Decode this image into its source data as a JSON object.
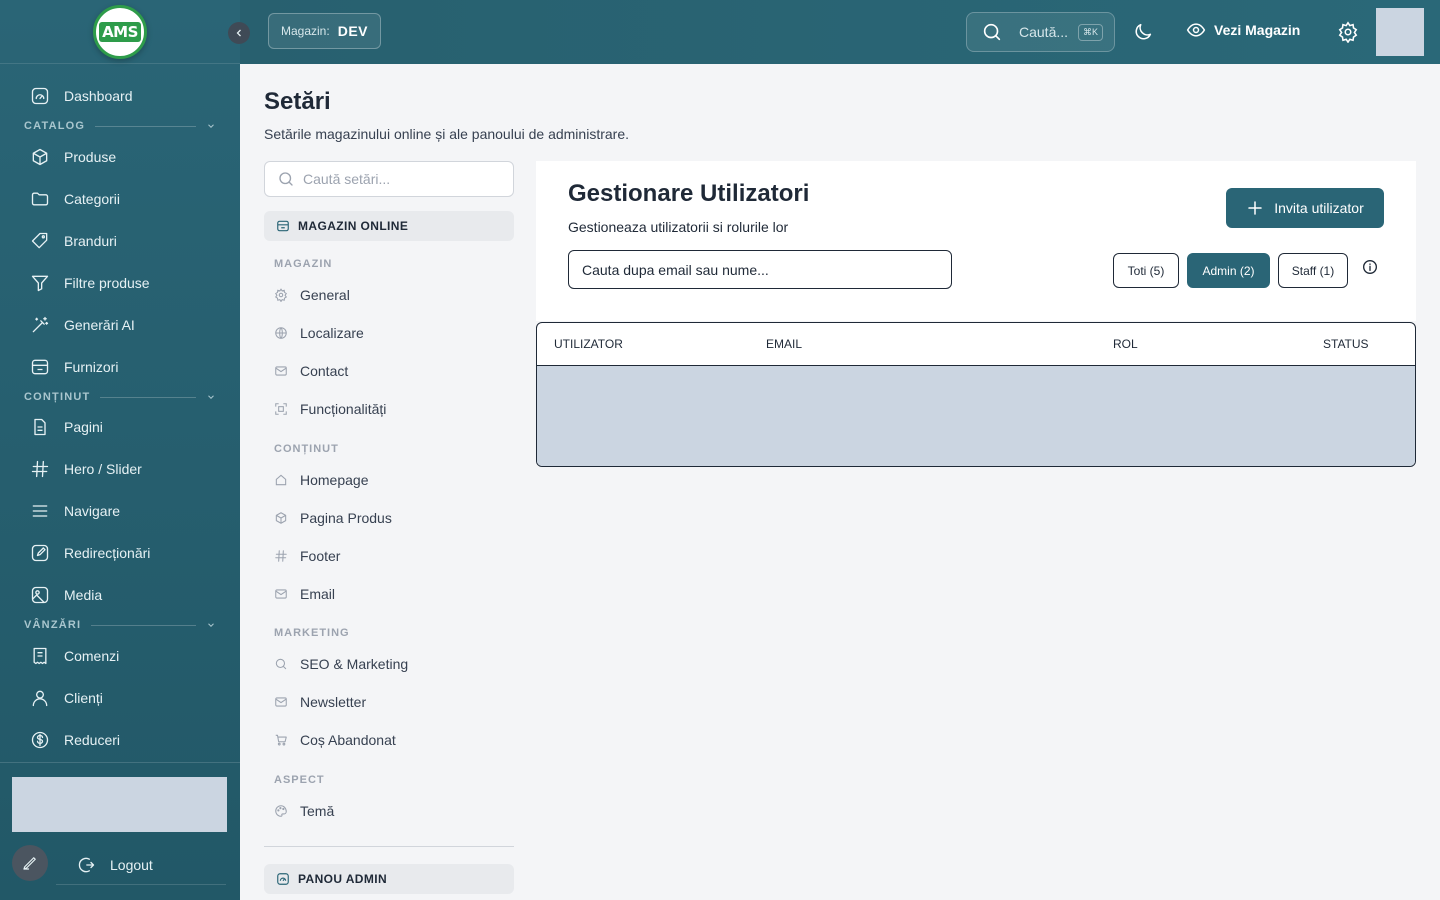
{
  "sidebar": {
    "logo_text": "AMS",
    "items": [
      {
        "label": "Dashboard",
        "icon": "gauge-icon"
      },
      {
        "label": "Produse",
        "icon": "box-icon"
      },
      {
        "label": "Categorii",
        "icon": "folder-icon"
      },
      {
        "label": "Branduri",
        "icon": "tag-icon"
      },
      {
        "label": "Filtre produse",
        "icon": "filter-icon"
      },
      {
        "label": "Generări AI",
        "icon": "wand-icon"
      },
      {
        "label": "Furnizori",
        "icon": "store-icon"
      },
      {
        "label": "Pagini",
        "icon": "file-icon"
      },
      {
        "label": "Hero / Slider",
        "icon": "hash-icon"
      },
      {
        "label": "Navigare",
        "icon": "menu-icon"
      },
      {
        "label": "Redirecționări",
        "icon": "edit-icon"
      },
      {
        "label": "Media",
        "icon": "image-icon"
      },
      {
        "label": "Comenzi",
        "icon": "receipt-icon"
      },
      {
        "label": "Clienți",
        "icon": "user-icon"
      },
      {
        "label": "Reduceri",
        "icon": "dollar-icon"
      }
    ],
    "sections": [
      "CATALOG",
      "CONȚINUT",
      "VÂNZĂRI"
    ],
    "logout_label": "Logout"
  },
  "topbar": {
    "store_label": "Magazin:",
    "store_value": "DEV",
    "search_placeholder": "Caută...",
    "search_shortcut": "⌘K",
    "view_store_label": "Vezi Magazin"
  },
  "main": {
    "title": "Setări",
    "subtitle": "Setările magazinului online și ale panoului de administrare."
  },
  "settings_nav": {
    "search_placeholder": "Caută setări...",
    "group_online": "MAGAZIN ONLINE",
    "group_admin": "PANOU ADMIN",
    "sections": [
      "MAGAZIN",
      "CONȚINUT",
      "MARKETING",
      "ASPECT"
    ],
    "items": [
      {
        "label": "General",
        "icon": "gear-icon"
      },
      {
        "label": "Localizare",
        "icon": "globe-icon"
      },
      {
        "label": "Contact",
        "icon": "mail-icon"
      },
      {
        "label": "Funcționalități",
        "icon": "scan-icon"
      },
      {
        "label": "Homepage",
        "icon": "home-icon"
      },
      {
        "label": "Pagina Produs",
        "icon": "box-icon"
      },
      {
        "label": "Footer",
        "icon": "hash-icon"
      },
      {
        "label": "Email",
        "icon": "mail-icon"
      },
      {
        "label": "SEO & Marketing",
        "icon": "search-icon"
      },
      {
        "label": "Newsletter",
        "icon": "mail-icon"
      },
      {
        "label": "Coș Abandonat",
        "icon": "cart-icon"
      },
      {
        "label": "Temă",
        "icon": "palette-icon"
      }
    ]
  },
  "users_panel": {
    "title": "Gestionare Utilizatori",
    "subtitle": "Gestioneaza utilizatorii si rolurile lor",
    "invite_label": "Invita utilizator",
    "search_placeholder": "Cauta dupa email sau nume...",
    "filters": [
      "Toti (5)",
      "Admin (2)",
      "Staff (1)"
    ],
    "active_filter": "Admin (2)",
    "columns": [
      "UTILIZATOR",
      "EMAIL",
      "ROL",
      "STATUS"
    ]
  },
  "colors": {
    "sidebar": "#2a6576",
    "accent": "#2a6576",
    "logo_green": "#2e9c4a",
    "placeholder": "#cbd5e1"
  }
}
